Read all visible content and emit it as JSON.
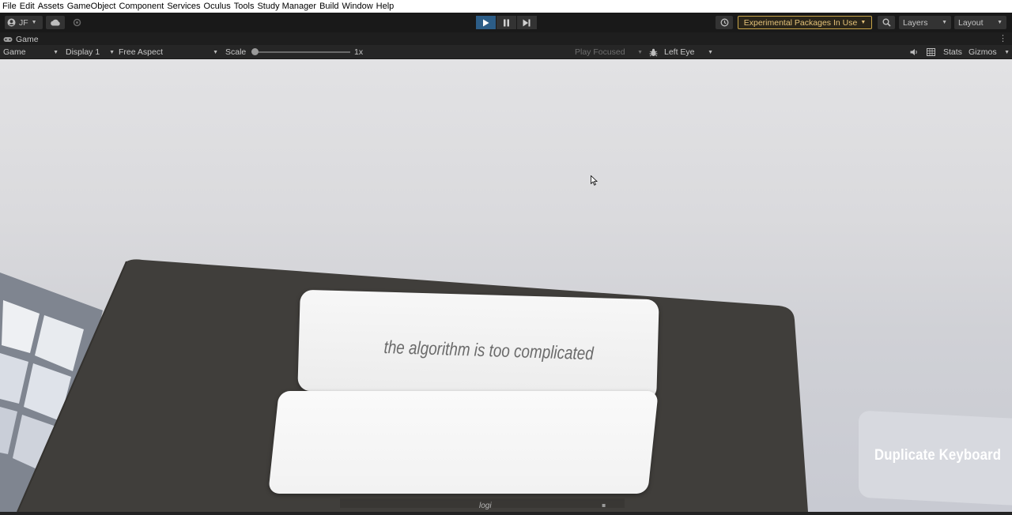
{
  "menu": [
    "File",
    "Edit",
    "Assets",
    "GameObject",
    "Component",
    "Services",
    "Oculus",
    "Tools",
    "Study Manager",
    "Build",
    "Window",
    "Help"
  ],
  "toolbar": {
    "account_label": "JF",
    "experimental_label": "Experimental Packages In Use",
    "layers_label": "Layers",
    "layout_label": "Layout",
    "play_state": "playing"
  },
  "tab": {
    "title": "Game"
  },
  "gamebar": {
    "mode": "Game",
    "display": "Display 1",
    "aspect": "Free Aspect",
    "scale_label": "Scale",
    "scale_value": "1x",
    "play_mode": "Play Focused",
    "eye": "Left Eye",
    "stats": "Stats",
    "gizmos": "Gizmos"
  },
  "scene": {
    "prompt_text": "the algorithm is too complicated",
    "input_text": "",
    "keyboard_brand": "logi",
    "duplicate_keyboard_label": "Duplicate Keyboard"
  },
  "colors": {
    "play_active": "#2c5d87",
    "experimental_border": "#c7a449",
    "desk": "#403e3b",
    "sky": "#d8d9dd"
  }
}
